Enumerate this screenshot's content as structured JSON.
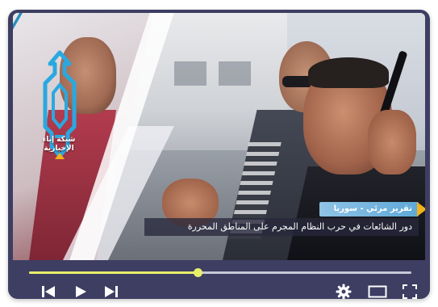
{
  "player": {
    "logo": {
      "icon": "channel-logo-icon",
      "text": "شبكة إباء الإخبارية"
    },
    "report_tag": "تقرير مرئي - سوريا",
    "headline": "دور الشائعات في حرب النظام المجرم على المناطق المحررة",
    "progress": 0.44,
    "colors": {
      "frame": "#3d3e62",
      "progress_accent": "#e7ef6a",
      "tag_bg": "#5ea8d8",
      "tag_arrow": "#f2b21c"
    },
    "controls": {
      "left": [
        "skip-back-icon",
        "play-icon",
        "skip-forward-icon"
      ],
      "right": [
        "settings-gear-icon",
        "theater-mode-icon",
        "fullscreen-icon"
      ]
    }
  }
}
